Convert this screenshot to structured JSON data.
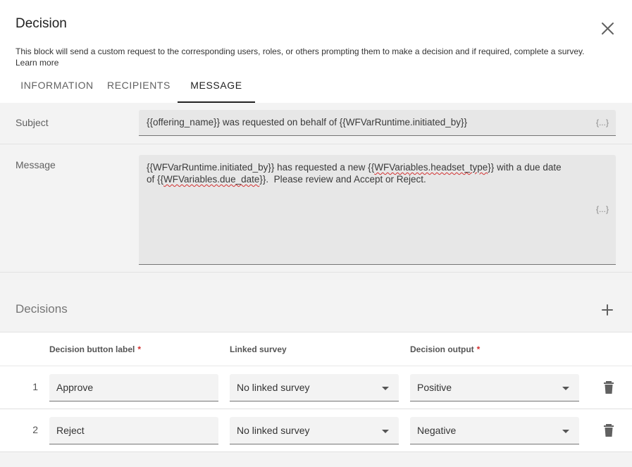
{
  "dialog": {
    "title": "Decision",
    "description": "This block will send a custom request to the corresponding users, roles, or others prompting them to make a decision and if required, complete a survey.",
    "learn_more": "Learn more",
    "close_icon": "close-icon"
  },
  "tabs": [
    {
      "label": "INFORMATION",
      "active": false
    },
    {
      "label": "RECIPIENTS",
      "active": false
    },
    {
      "label": "MESSAGE",
      "active": true
    }
  ],
  "subject": {
    "label": "Subject",
    "value": "{{offering_name}} was requested on behalf of {{WFVarRuntime.initiated_by}}",
    "var_button": "{...}"
  },
  "message": {
    "label": "Message",
    "part1": "{{WFVarRuntime.initiated_by}} has requested a new {{",
    "var1": "WFVariables.headset_type",
    "part2": "}} with a due date\nof {{",
    "var2": "WFVariables.due_date",
    "part3": "}}.  Please review and Accept or Reject.",
    "var_button": "{...}"
  },
  "decisions": {
    "title": "Decisions",
    "add_icon": "plus-icon",
    "columns": {
      "button_label": "Decision button label",
      "linked_survey": "Linked survey",
      "output": "Decision output",
      "required_mark": "*"
    },
    "rows": [
      {
        "number": "1",
        "label": "Approve",
        "survey": "No linked survey",
        "output": "Positive"
      },
      {
        "number": "2",
        "label": "Reject",
        "survey": "No linked survey",
        "output": "Negative"
      }
    ]
  },
  "colors": {
    "accent": "#212121",
    "required": "#d32f2f",
    "panel_bg": "#f3f3f3"
  }
}
